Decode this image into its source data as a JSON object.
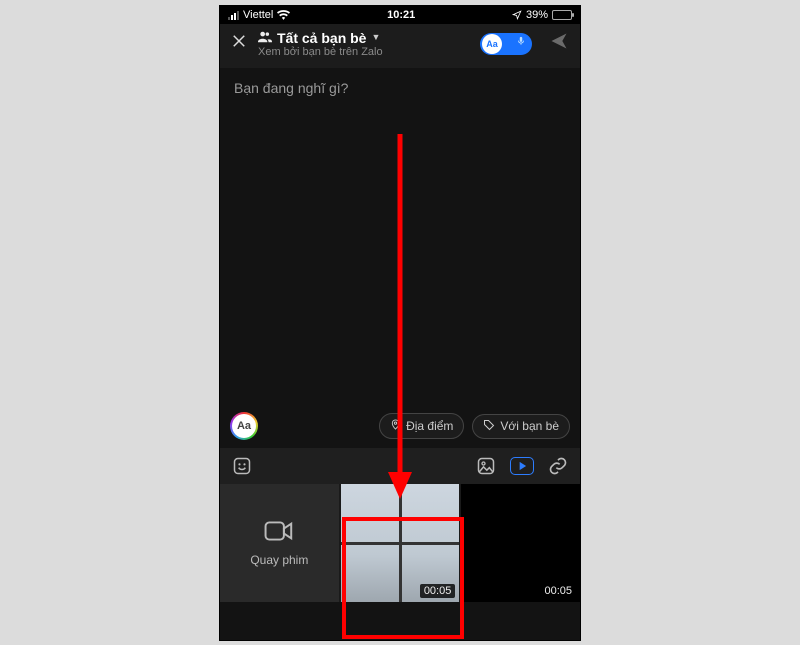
{
  "statusbar": {
    "carrier": "Viettel",
    "time": "10:21",
    "battery_pct": "39%"
  },
  "header": {
    "title": "Tất cả bạn bè",
    "subtitle": "Xem bởi bạn bè trên Zalo",
    "toggle_text": "Aa"
  },
  "compose": {
    "placeholder": "Bạn đang nghĩ gì?"
  },
  "chips": {
    "aa_label": "Aa",
    "location": "Địa điểm",
    "with_friends": "Với bạn bè"
  },
  "media": {
    "record_label": "Quay phim",
    "thumb1_duration": "00:05",
    "thumb2_duration": "00:05"
  }
}
